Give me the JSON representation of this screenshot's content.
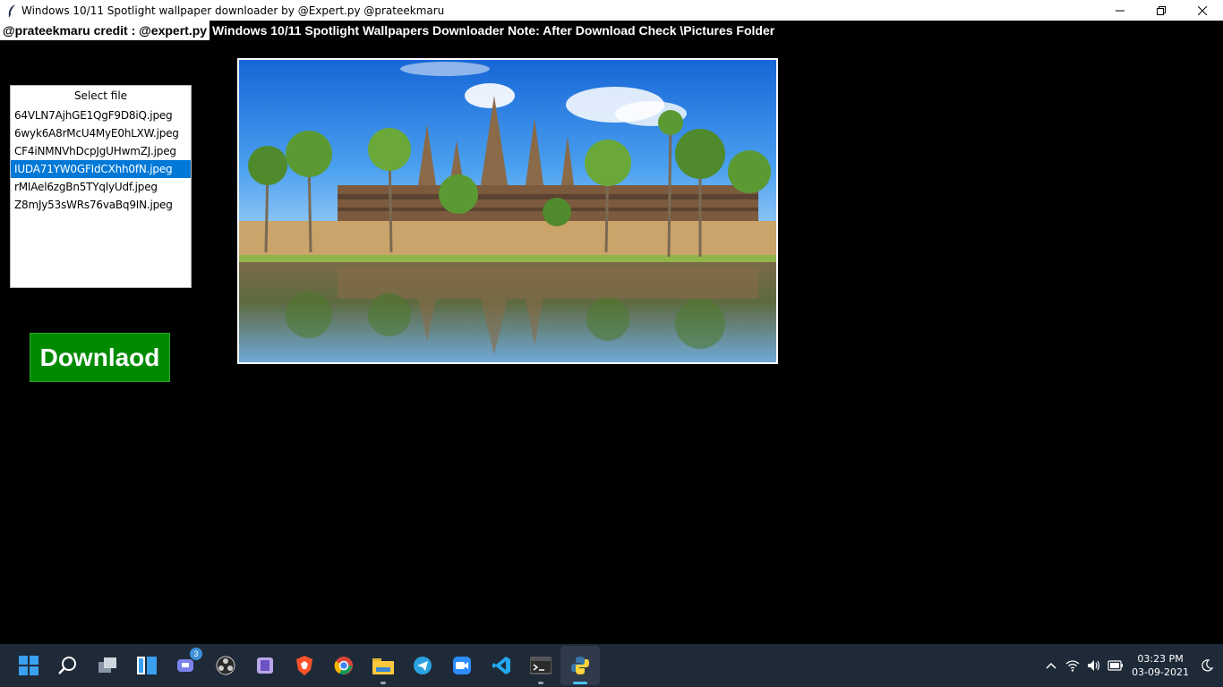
{
  "window": {
    "title": "Windows 10/11 Spotlight wallpaper downloader by @Expert.py @prateekmaru",
    "app_icon": "feather-icon"
  },
  "header": {
    "credit": "@prateekmaru credit : @expert.py",
    "note": "Windows 10/11 Spotlight Wallpapers Downloader Note: After Download Check \\Pictures Folder"
  },
  "file_list": {
    "title": "Select file",
    "items": [
      "64VLN7AjhGE1QgF9D8iQ.jpeg",
      "6wyk6A8rMcU4MyE0hLXW.jpeg",
      "CF4iNMNVhDcpJgUHwmZJ.jpeg",
      "IUDA71YW0GFIdCXhh0fN.jpeg",
      "rMIAel6zgBn5TYqlyUdf.jpeg",
      "Z8mJy53sWRs76vaBq9IN.jpeg"
    ],
    "selected_index": 3
  },
  "download_button": {
    "label": "Downlaod",
    "color": "#008a00"
  },
  "preview": {
    "subject": "temple-reflection-landscape"
  },
  "taskbar": {
    "apps": [
      "windows-start-icon",
      "search-icon",
      "task-view-icon",
      "widgets-icon",
      "teams-chat-icon",
      "obs-icon",
      "notes-icon",
      "brave-icon",
      "chrome-icon",
      "file-explorer-icon",
      "telegram-icon",
      "zoom-icon",
      "vscode-icon",
      "terminal-icon",
      "python-icon"
    ],
    "chat_badge": "3",
    "time": "03:23 PM",
    "date": "03-09-2021"
  },
  "colors": {
    "selection": "#0078d7",
    "background": "#000000",
    "taskbar": "#1f2a38"
  }
}
